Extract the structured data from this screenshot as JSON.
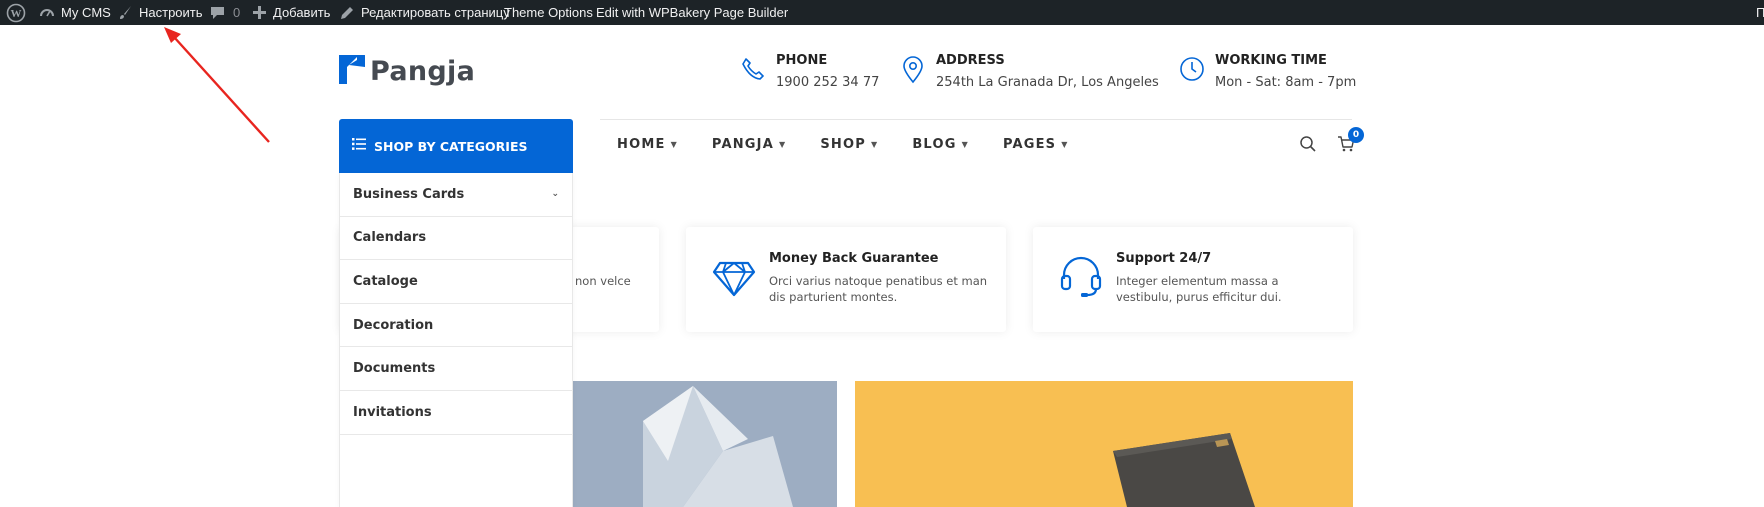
{
  "adminbar": {
    "site_name": "My CMS",
    "customize": "Настроить",
    "comments_count": "0",
    "add_new": "Добавить",
    "edit_page": "Редактировать страницу",
    "theme_options": "Theme Options",
    "edit_wpbakery": "Edit with WPBakery Page Builder",
    "right_cut": "П"
  },
  "header": {
    "logo_text": "Pangja",
    "phone": {
      "title": "PHONE",
      "value": "1900 252 34 77"
    },
    "address": {
      "title": "ADDRESS",
      "value": "254th La Granada Dr, Los Angeles"
    },
    "working_time": {
      "title": "WORKING TIME",
      "value": "Mon - Sat: 8am - 7pm"
    }
  },
  "nav": {
    "shop_by_categories": "SHOP BY CATEGORIES",
    "items": [
      "HOME",
      "PANGJA",
      "SHOP",
      "BLOG",
      "PAGES"
    ],
    "cart_count": "0"
  },
  "categories": [
    "Business Cards",
    "Calendars",
    "Cataloge",
    "Decoration",
    "Documents",
    "Invitations"
  ],
  "features": [
    {
      "title": "",
      "desc_visible": "non velce"
    },
    {
      "title": "Money Back Guarantee",
      "desc": "Orci varius natoque penatibus et man dis parturient montes."
    },
    {
      "title": "Support 24/7",
      "desc": "Integer elementum massa a vestibulu, purus efficitur dui."
    }
  ],
  "colors": {
    "brand_blue": "#0466d6",
    "adminbar_bg": "#1d2327",
    "banner_left": "#9dadc2",
    "banner_right": "#f8bf52",
    "annotation_arrow": "#e8251f"
  }
}
